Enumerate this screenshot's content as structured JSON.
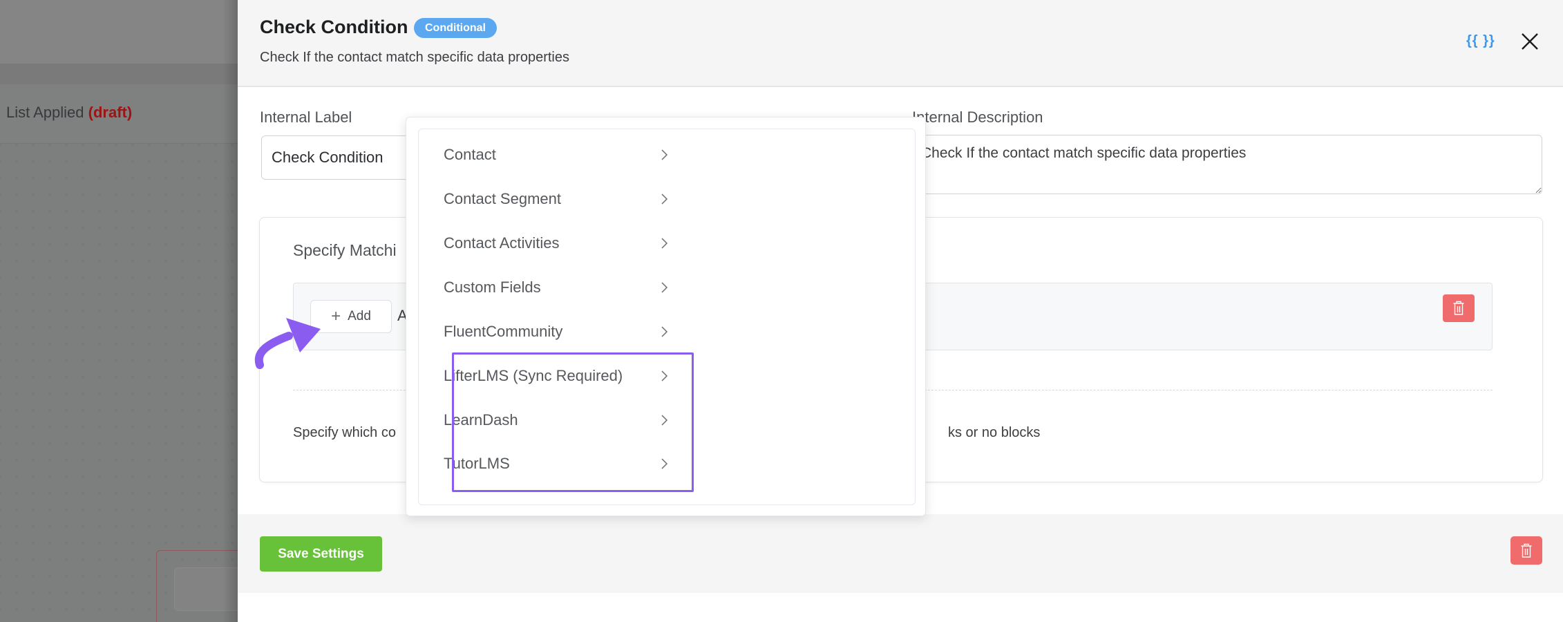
{
  "background": {
    "workflow_title": "List Applied",
    "workflow_status": "(draft)"
  },
  "modal": {
    "title": "Check Condition",
    "badge": "Conditional",
    "subtitle": "Check If the contact match specific data properties",
    "smartcode_label": "{{ }}",
    "icons": {
      "smartcode": "smartcode-icon",
      "close": "close-icon"
    }
  },
  "form": {
    "internal_label": {
      "label": "Internal Label",
      "value": "Check Condition"
    },
    "internal_description": {
      "label": "Internal Description",
      "value": "Check If the contact match specific data properties"
    }
  },
  "matching": {
    "title_visible": "Specify Matchi",
    "add_button_label": "Add",
    "and_fragment": "A",
    "help_left_visible": "Specify which co",
    "help_right_visible": "ks or no blocks"
  },
  "dropdown": {
    "items": [
      {
        "label": "Contact",
        "highlighted": false
      },
      {
        "label": "Contact Segment",
        "highlighted": false
      },
      {
        "label": "Contact Activities",
        "highlighted": false
      },
      {
        "label": "Custom Fields",
        "highlighted": false
      },
      {
        "label": "FluentCommunity",
        "highlighted": false
      },
      {
        "label": "LifterLMS (Sync Required)",
        "highlighted": true
      },
      {
        "label": "LearnDash",
        "highlighted": true
      },
      {
        "label": "TutorLMS",
        "highlighted": true
      }
    ],
    "highlight_color": "#8b5cf0"
  },
  "footer": {
    "save_label": "Save Settings"
  },
  "colors": {
    "badge": "#5ba8f0",
    "save": "#67c23a",
    "delete": "#f06b6b",
    "draft": "#9c1414",
    "annotation": "#8b5cf0"
  }
}
